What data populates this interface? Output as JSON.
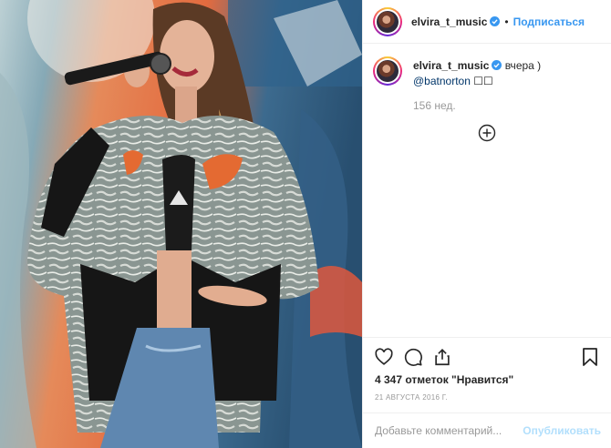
{
  "post": {
    "username": "elvira_t_music",
    "follow_label": "Подписаться",
    "separator": "•"
  },
  "caption": {
    "username": "elvira_t_music",
    "text": " вчера )",
    "mention": "@batnorton",
    "emoji": " ☐☐",
    "time": "156 нед."
  },
  "actions": {
    "likes": "4 347 отметок \"Нравится\"",
    "date": "21 АВГУСТА 2016 Г.",
    "comment_placeholder": "Добавьте комментарий...",
    "publish_label": "Опубликовать"
  },
  "icons": [
    "verified-badge-icon",
    "plus-circle-icon",
    "heart-icon",
    "comment-icon",
    "share-icon",
    "bookmark-icon"
  ],
  "colors": {
    "link": "#3897f0",
    "publish_disabled": "#b2dffc",
    "muted": "#999999",
    "border": "#efefef"
  }
}
